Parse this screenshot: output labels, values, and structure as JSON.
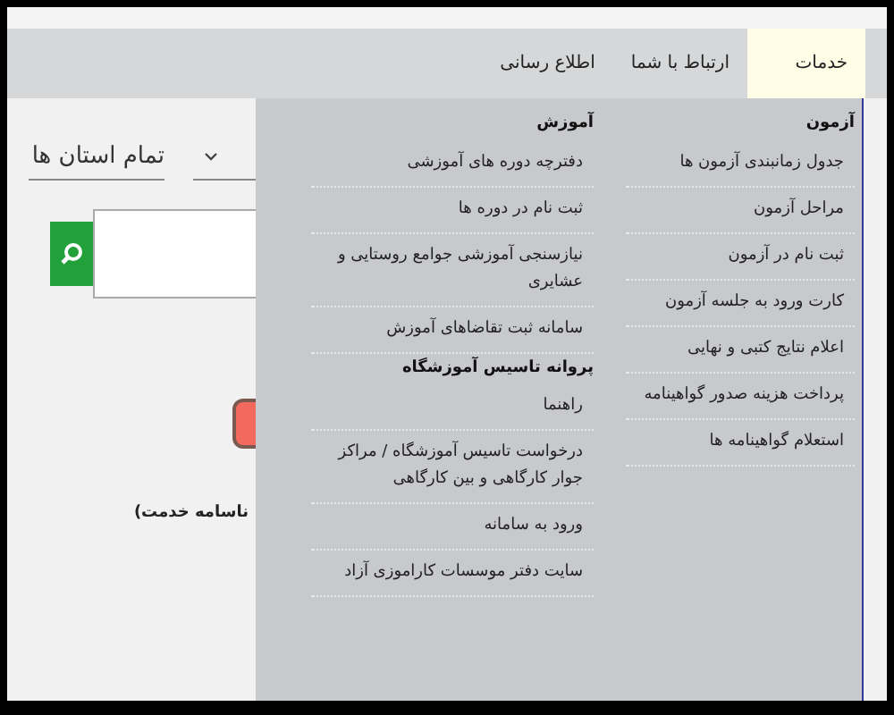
{
  "nav": {
    "items": [
      {
        "label": "خدمات",
        "selected": true
      },
      {
        "label": "ارتباط با شما",
        "selected": false
      },
      {
        "label": "اطلاع رسانی",
        "selected": false
      }
    ]
  },
  "filters": {
    "province_select": {
      "value": "تمام استان ها"
    },
    "caption": "ناسامه خدمت)"
  },
  "menu": {
    "columns": [
      {
        "groups": [
          {
            "heading": "آزمون",
            "items": [
              "جدول زمانبندی آزمون ها",
              "مراحل آزمون",
              "ثبت نام در آزمون",
              "کارت ورود به جلسه آزمون",
              "اعلام نتایج کتبی و نهایی",
              "پرداخت هزینه صدور گواهینامه",
              "استعلام گواهینامه ها"
            ]
          }
        ]
      },
      {
        "groups": [
          {
            "heading": "آموزش",
            "items": [
              "دفترچه دوره های آموزشی",
              "ثبت نام در دوره ها",
              "نیازسنجی آموزشی جوامع روستایی و عشایری",
              "سامانه ثبت تقاضاهای آموزش"
            ]
          },
          {
            "heading": "پروانه تاسیس آموزشگاه",
            "items": [
              "راهنما",
              "درخواست تاسیس آموزشگاه / مراکز جوار کارگاهی و بین کارگاهی",
              "ورود به سامانه",
              "سایت دفتر موسسات کاراموزی آزاد"
            ]
          }
        ]
      }
    ]
  }
}
